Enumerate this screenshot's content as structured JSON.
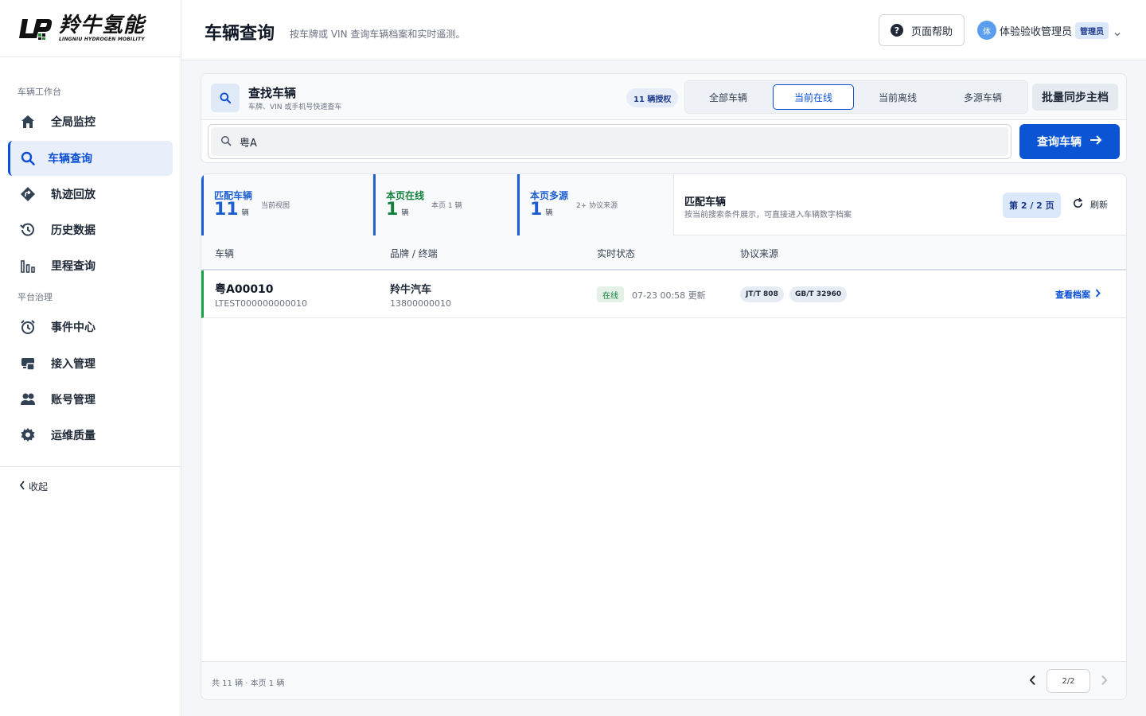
{
  "brand": {
    "name_cn": "羚牛氢能",
    "name_en": "LINGNIU HYDROGEN MOBILITY"
  },
  "sidebar": {
    "sections": [
      {
        "label": "车辆工作台"
      },
      {
        "label": "平台治理"
      }
    ],
    "items": [
      {
        "label": "全局监控",
        "icon": "home-icon"
      },
      {
        "label": "车辆查询",
        "icon": "search-icon",
        "active": true
      },
      {
        "label": "轨迹回放",
        "icon": "route-icon"
      },
      {
        "label": "历史数据",
        "icon": "history-icon"
      },
      {
        "label": "里程查询",
        "icon": "bar-chart-icon"
      },
      {
        "label": "事件中心",
        "icon": "alarm-clock-icon"
      },
      {
        "label": "接入管理",
        "icon": "device-link-icon"
      },
      {
        "label": "账号管理",
        "icon": "users-icon"
      },
      {
        "label": "运维质量",
        "icon": "gear-icon"
      }
    ],
    "collapse_label": "收起"
  },
  "header": {
    "title": "车辆查询",
    "subtitle": "按车牌或 VIN 查询车辆档案和实时遥测。",
    "help_label": "页面帮助",
    "user": {
      "avatar_char": "体",
      "name": "体验验收管理员",
      "role": "管理员"
    }
  },
  "search": {
    "title": "查找车辆",
    "subtitle": "车牌、VIN 或手机号快速查车",
    "auth_count": "11 辆授权",
    "tabs": [
      {
        "label": "全部车辆",
        "active": false
      },
      {
        "label": "当前在线",
        "active": true
      },
      {
        "label": "当前离线",
        "active": false
      },
      {
        "label": "多源车辆",
        "active": false
      }
    ],
    "sync_label": "批量同步主档",
    "query_value": "粤A",
    "query_button": "查询车辆"
  },
  "stats": [
    {
      "label": "匹配车辆",
      "value": "11",
      "unit": "辆",
      "note": "当前视图",
      "color": "#1d5fd1"
    },
    {
      "label": "本页在线",
      "value": "1",
      "unit": "辆",
      "note": "本页 1 辆",
      "color": "#15803d"
    },
    {
      "label": "本页多源",
      "value": "1",
      "unit": "辆",
      "note": "2+ 协议来源",
      "color": "#1d5fd1"
    }
  ],
  "results_header": {
    "title": "匹配车辆",
    "subtitle": "按当前搜索条件展示，可直接进入车辆数字档案",
    "page": "第 2 / 2 页",
    "refresh_label": "刷新"
  },
  "table": {
    "columns": [
      "车辆",
      "品牌 / 终端",
      "实时状态",
      "协议来源"
    ],
    "rows": [
      {
        "plate": "粤A00010",
        "vin": "LTEST000000000010",
        "brand": "羚牛汽车",
        "phone": "13800000010",
        "status": "在线",
        "updated": "07-23 00:58 更新",
        "protocols": [
          "JT/T 808",
          "GB/T 32960"
        ],
        "action": "查看档案"
      }
    ]
  },
  "footer": {
    "total": "共 11 辆 · 本页 1 辆",
    "page_indicator": "2/2"
  }
}
